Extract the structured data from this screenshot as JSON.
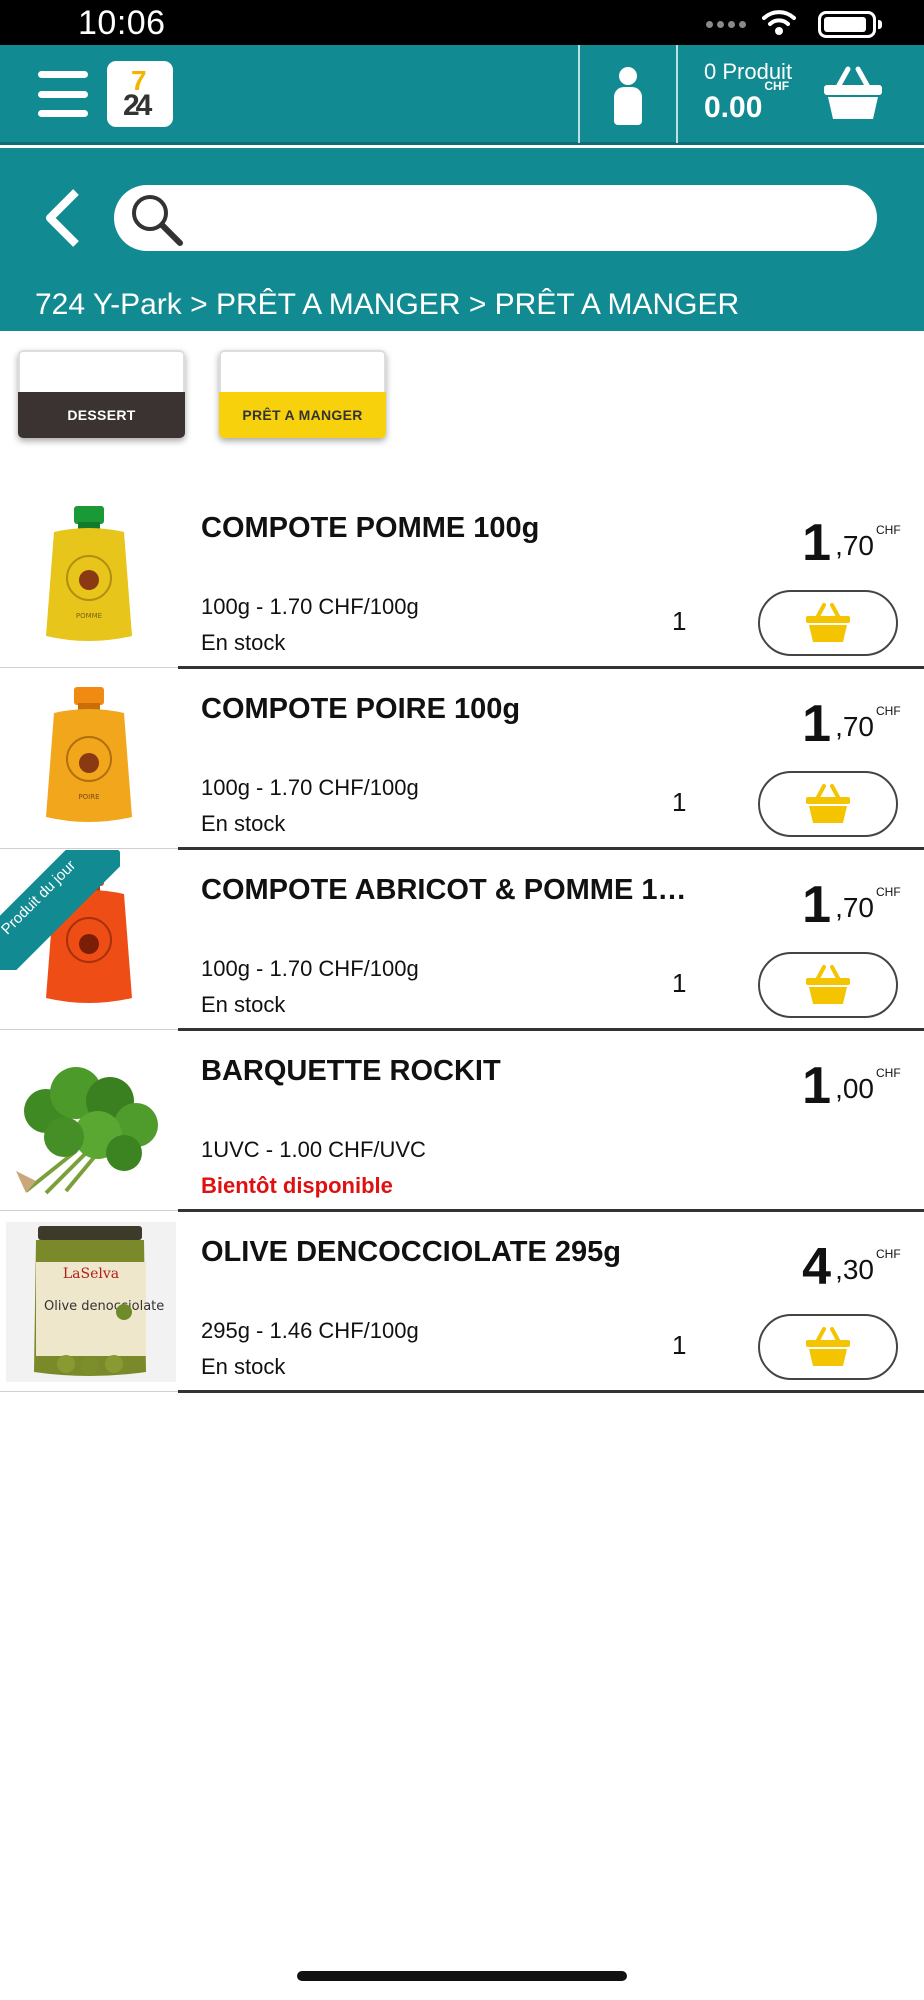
{
  "status_bar": {
    "time": "10:06"
  },
  "header": {
    "cart_count": "0 Produit",
    "cart_total": "0.00",
    "cart_currency": "CHF"
  },
  "search": {
    "placeholder": ""
  },
  "breadcrumb": "724 Y-Park > PRÊT A MANGER > PRÊT A MANGER",
  "categories": [
    {
      "label": "DESSERT"
    },
    {
      "label": "PRÊT A MANGER"
    }
  ],
  "products": [
    {
      "name": "COMPOTE POMME 100g",
      "price_int": "1",
      "price_dec": ",70",
      "currency": "CHF",
      "unit_info": "100g - 1.70 CHF/100g",
      "stock": "En stock",
      "qty": "1"
    },
    {
      "name": "COMPOTE POIRE 100g",
      "price_int": "1",
      "price_dec": ",70",
      "currency": "CHF",
      "unit_info": "100g - 1.70 CHF/100g",
      "stock": "En stock",
      "qty": "1"
    },
    {
      "name": "COMPOTE ABRICOT & POMME 1…",
      "price_int": "1",
      "price_dec": ",70",
      "currency": "CHF",
      "unit_info": "100g - 1.70 CHF/100g",
      "stock": "En stock",
      "qty": "1",
      "ribbon": "Produit du jour"
    },
    {
      "name": "BARQUETTE ROCKIT",
      "price_int": "1",
      "price_dec": ",00",
      "currency": "CHF",
      "unit_info": "1UVC - 1.00 CHF/UVC",
      "stock": "Bientôt disponible"
    },
    {
      "name": "OLIVE DENCOCCIOLATE 295g",
      "price_int": "4",
      "price_dec": ",30",
      "currency": "CHF",
      "unit_info": "295g - 1.46 CHF/100g",
      "stock": "En stock",
      "qty": "1",
      "jar_brand": "LaSelva",
      "jar_text": "Olive denocciolate"
    }
  ],
  "colors": {
    "brand_teal": "#128a92",
    "accent_yellow": "#f8d10d",
    "dessert_chip": "#3a3331",
    "unavailable_red": "#e01010"
  }
}
